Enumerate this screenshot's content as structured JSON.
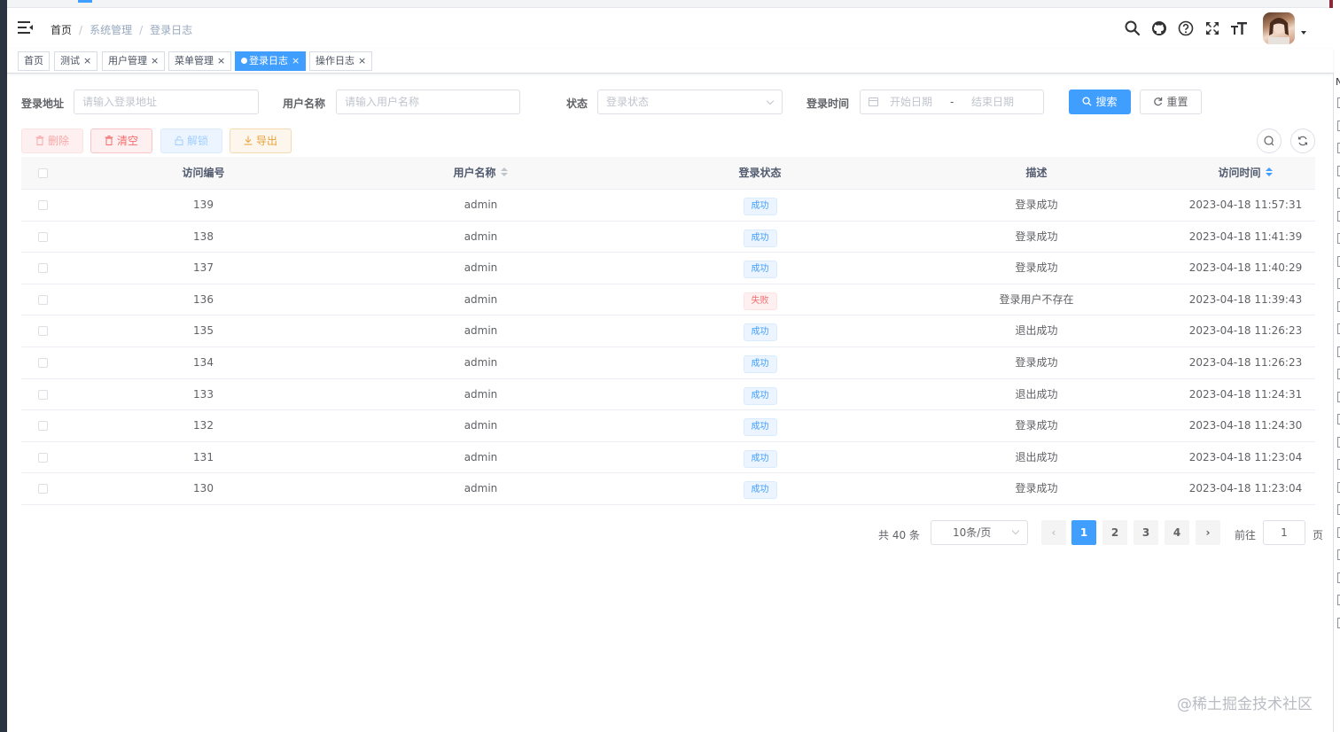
{
  "navbar": {
    "breadcrumb": [
      "首页",
      "系统管理",
      "登录日志"
    ],
    "breadcrumb_sep": "/"
  },
  "icons": {
    "menu": "hamburger-fold-icon",
    "search": "search-icon",
    "github": "github-icon",
    "help": "question-circle-icon",
    "fullscreen": "fullscreen-icon",
    "font_size": "font-size-icon",
    "avatar": "user-avatar"
  },
  "tags": [
    {
      "label": "首页",
      "closable": false,
      "active": false
    },
    {
      "label": "测试",
      "closable": true,
      "active": false
    },
    {
      "label": "用户管理",
      "closable": true,
      "active": false
    },
    {
      "label": "菜单管理",
      "closable": true,
      "active": false
    },
    {
      "label": "登录日志",
      "closable": true,
      "active": true
    },
    {
      "label": "操作日志",
      "closable": true,
      "active": false
    }
  ],
  "tag_close": "×",
  "search_form": {
    "ipaddr_label": "登录地址",
    "ipaddr_placeholder": "请输入登录地址",
    "username_label": "用户名称",
    "username_placeholder": "请输入用户名称",
    "status_label": "状态",
    "status_placeholder": "登录状态",
    "time_label": "登录时间",
    "start_placeholder": "开始日期",
    "range_sep": "-",
    "end_placeholder": "结束日期",
    "search_button": "搜索",
    "reset_button": "重置"
  },
  "toolbar": {
    "delete": "删除",
    "clear": "清空",
    "unlock": "解锁",
    "export": "导出"
  },
  "table": {
    "columns": [
      "访问编号",
      "用户名称",
      "登录状态",
      "描述",
      "访问时间"
    ],
    "rows": [
      {
        "id": "139",
        "user": "admin",
        "status": "成功",
        "ok": true,
        "desc": "登录成功",
        "time": "2023-04-18 11:57:31"
      },
      {
        "id": "138",
        "user": "admin",
        "status": "成功",
        "ok": true,
        "desc": "登录成功",
        "time": "2023-04-18 11:41:39"
      },
      {
        "id": "137",
        "user": "admin",
        "status": "成功",
        "ok": true,
        "desc": "登录成功",
        "time": "2023-04-18 11:40:29"
      },
      {
        "id": "136",
        "user": "admin",
        "status": "失败",
        "ok": false,
        "desc": "登录用户不存在",
        "time": "2023-04-18 11:39:43"
      },
      {
        "id": "135",
        "user": "admin",
        "status": "成功",
        "ok": true,
        "desc": "退出成功",
        "time": "2023-04-18 11:26:23"
      },
      {
        "id": "134",
        "user": "admin",
        "status": "成功",
        "ok": true,
        "desc": "登录成功",
        "time": "2023-04-18 11:26:23"
      },
      {
        "id": "133",
        "user": "admin",
        "status": "成功",
        "ok": true,
        "desc": "退出成功",
        "time": "2023-04-18 11:24:31"
      },
      {
        "id": "132",
        "user": "admin",
        "status": "成功",
        "ok": true,
        "desc": "登录成功",
        "time": "2023-04-18 11:24:30"
      },
      {
        "id": "131",
        "user": "admin",
        "status": "成功",
        "ok": true,
        "desc": "退出成功",
        "time": "2023-04-18 11:23:04"
      },
      {
        "id": "130",
        "user": "admin",
        "status": "成功",
        "ok": true,
        "desc": "登录成功",
        "time": "2023-04-18 11:23:04"
      }
    ]
  },
  "pagination": {
    "total_text": "共 40 条",
    "page_size": "10条/页",
    "pages": [
      "1",
      "2",
      "3",
      "4"
    ],
    "current": "1",
    "prev": "‹",
    "next": "›",
    "goto_label": "前往",
    "goto_value": "1",
    "page_label": "页"
  },
  "right_panel_letter": "N",
  "watermark": "@稀土掘金技术社区",
  "colors": {
    "primary": "#409eff",
    "danger": "#f56c6c",
    "warning": "#e6a23c",
    "sidebar": "#2b3441"
  }
}
